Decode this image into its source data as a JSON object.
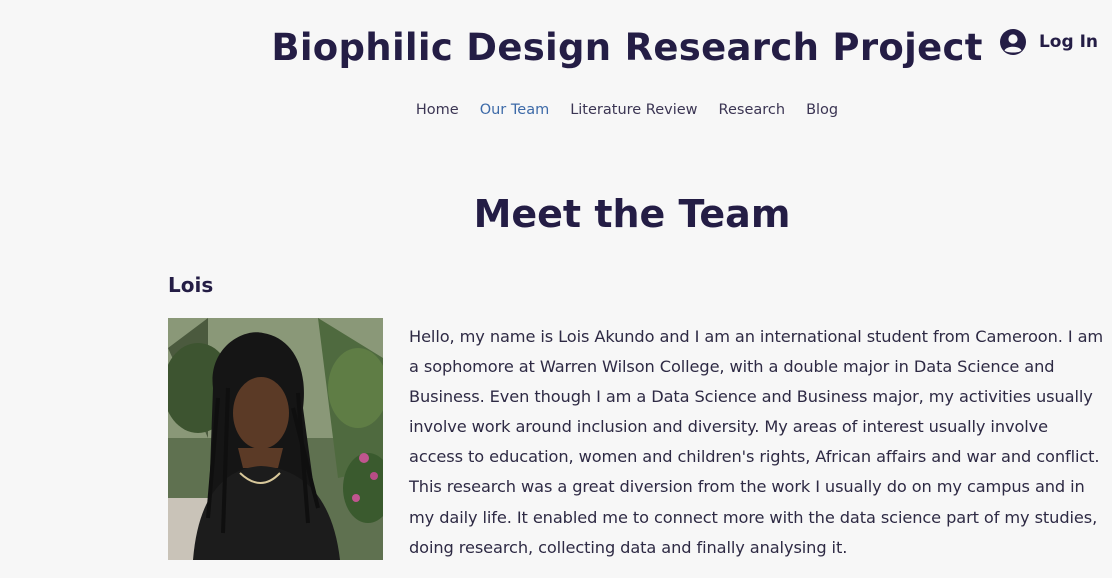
{
  "site": {
    "title": "Biophilic Design Research Project"
  },
  "header": {
    "login_label": "Log In"
  },
  "nav": {
    "items": [
      "Home",
      "Our Team",
      "Literature Review",
      "Research",
      "Blog"
    ],
    "active": "Our Team"
  },
  "main": {
    "section_title": "Meet the Team",
    "member": {
      "name": "Lois",
      "bio": "Hello, my name is Lois Akundo and I am an international student from Cameroon. I am a sophomore at Warren Wilson College, with a double major in Data Science and Business. Even though I am a Data Science and Business major, my activities usually involve work around inclusion and diversity. My areas of interest usually involve access to education, women and children's rights, African affairs and war and conflict. This research was a great diversion from the work I usually do on my campus and in my daily life. It enabled me to connect more with the data science part of my studies, doing research, collecting data and finally analysing it."
    }
  },
  "colors": {
    "title": "#241d45",
    "nav_active": "#3d6aa8",
    "nav_text": "#3b3553",
    "background": "#f7f7f7"
  },
  "icons": {
    "login": "account-circle-icon"
  }
}
